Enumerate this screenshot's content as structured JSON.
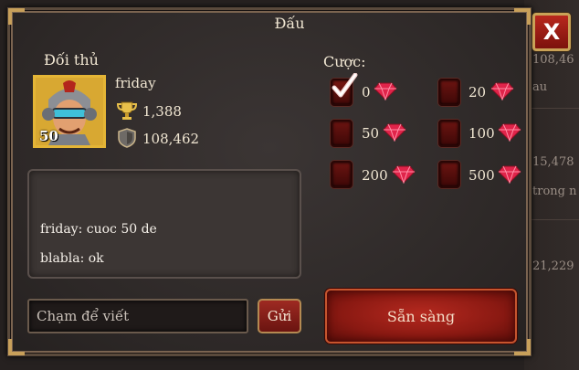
{
  "dialog": {
    "title": "Đấu",
    "close_label": "X"
  },
  "opponent": {
    "section_label": "Đối thủ",
    "name": "friday",
    "level": "50",
    "trophies": "1,388",
    "power": "108,462",
    "avatar_icon": "hero-portrait-icon",
    "trophy_icon": "trophy-icon",
    "power_icon": "shield-icon"
  },
  "chat": {
    "messages": [
      {
        "text": "friday: cuoc 50 de"
      },
      {
        "text": "blabla: ok"
      }
    ],
    "input_placeholder": "Chạm để viết",
    "send_label": "Gửi"
  },
  "bet": {
    "label": "Cược:",
    "gem_icon": "ruby-gem-icon",
    "selected_value": "0",
    "options": [
      {
        "value": "0",
        "checked": true
      },
      {
        "value": "20",
        "checked": false
      },
      {
        "value": "50",
        "checked": false
      },
      {
        "value": "100",
        "checked": false
      },
      {
        "value": "200",
        "checked": false
      },
      {
        "value": "500",
        "checked": false
      }
    ]
  },
  "ready_label": "Sẵn sàng",
  "background": {
    "texts": [
      "108,46",
      "au",
      "15,478",
      "trong n",
      "21,229"
    ]
  },
  "colors": {
    "accent_red": "#9e2a22",
    "gold": "#e4b536",
    "text": "#f0e6d2",
    "gem": "#e0244a"
  }
}
